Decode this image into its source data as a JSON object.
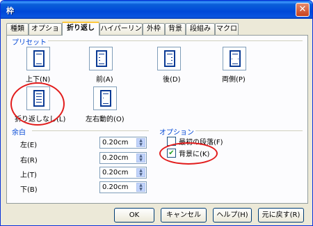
{
  "window": {
    "title": "枠",
    "close_glyph": "✕"
  },
  "tabs": [
    {
      "label": "種類"
    },
    {
      "label": "オプション"
    },
    {
      "label": "折り返し",
      "active": true
    },
    {
      "label": "ハイパーリンク"
    },
    {
      "label": "外枠"
    },
    {
      "label": "背景"
    },
    {
      "label": "段組み"
    },
    {
      "label": "マクロ"
    }
  ],
  "presets": {
    "title": "プリセット",
    "items": [
      {
        "label": "上下(N)",
        "icon": "wrap-none-icon"
      },
      {
        "label": "前(A)",
        "icon": "wrap-before-icon"
      },
      {
        "label": "後(D)",
        "icon": "wrap-after-icon"
      },
      {
        "label": "両側(P)",
        "icon": "wrap-parallel-icon"
      },
      {
        "label": "折り返しなし(L)",
        "icon": "wrap-through-icon",
        "selected": true
      },
      {
        "label": "左右動的(O)",
        "icon": "wrap-optimal-icon"
      }
    ]
  },
  "spacing": {
    "title": "余白",
    "fields": [
      {
        "label": "左(E)",
        "value": "0.20cm"
      },
      {
        "label": "右(R)",
        "value": "0.20cm"
      },
      {
        "label": "上(T)",
        "value": "0.20cm"
      },
      {
        "label": "下(B)",
        "value": "0.20cm"
      }
    ]
  },
  "options": {
    "title": "オプション",
    "checkboxes": [
      {
        "label": "最初の段落(F)",
        "checked": false
      },
      {
        "label": "背景に(K)",
        "checked": true
      }
    ]
  },
  "buttons": {
    "ok": "OK",
    "cancel": "キャンセル",
    "help": "ヘルプ(H)",
    "reset": "元に戻す(R)"
  },
  "colors": {
    "accent": "#0046d5",
    "annotation": "#e21c1c",
    "title_bar": "#0048d8"
  }
}
